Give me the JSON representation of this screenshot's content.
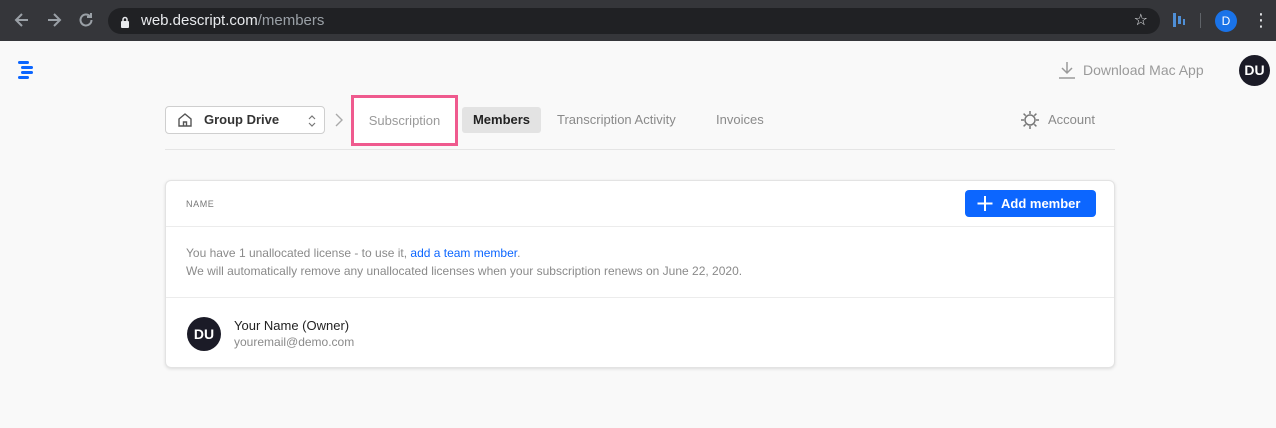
{
  "browser": {
    "url_host": "web.descript.com",
    "url_path": "/members",
    "profile_initial": "D",
    "icons": [
      "back-arrow-icon",
      "forward-arrow-icon",
      "reload-icon",
      "lock-icon",
      "star-icon",
      "extension-icon",
      "kebab-menu-icon"
    ]
  },
  "header": {
    "download_label": "Download Mac App",
    "avatar_initials": "DU"
  },
  "nav": {
    "drive_label": "Group Drive",
    "tabs": [
      {
        "label": "Subscription",
        "highlighted": true
      },
      {
        "label": "Members",
        "active": true
      },
      {
        "label": "Transcription Activity"
      },
      {
        "label": "Invoices"
      }
    ],
    "account_label": "Account"
  },
  "members_card": {
    "column_header": "NAME",
    "add_button_label": "Add member",
    "notice_line1_prefix": "You have 1 unallocated license - to use it,",
    "notice_link": "add a team member",
    "notice_line1_suffix": ".",
    "notice_line2": "We will automatically remove any unallocated licenses when your subscription renews on June 22, 2020.",
    "members": [
      {
        "initials": "DU",
        "name": "Your Name (Owner)",
        "email": "youremail@demo.com"
      }
    ]
  },
  "colors": {
    "accent_blue": "#0c66ff",
    "highlight_pink": "#ef5a8e",
    "chrome_dark": "#35363a",
    "avatar_dark": "#1b1b27"
  }
}
